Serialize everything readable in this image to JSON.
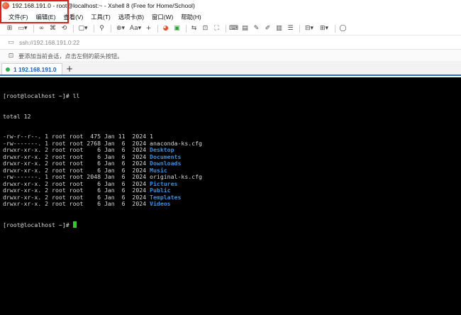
{
  "window": {
    "title": "192.168.191.0 - root@localhost:~ - Xshell 8 (Free for Home/School)"
  },
  "menu": [
    "文件(F)",
    "编辑(E)",
    "查看(V)",
    "工具(T)",
    "选项卡(B)",
    "窗口(W)",
    "帮助(H)"
  ],
  "address": {
    "value": "ssh://192.168.191.0:22"
  },
  "info": {
    "text": "要添加当前会话，点击左侧的箭头按钮。"
  },
  "tab": {
    "label": "1 192.168.191.0",
    "add_label": "+"
  },
  "terminal": {
    "prompt": "[root@localhost ~]# ",
    "command": "ll",
    "total": "total 12",
    "files": [
      {
        "meta": "-rw-r--r--. 1 root root  475 Jan 11  2024 ",
        "name": "1",
        "dir": false
      },
      {
        "meta": "-rw-------. 1 root root 2768 Jan  6  2024 ",
        "name": "anaconda-ks.cfg",
        "dir": false
      },
      {
        "meta": "drwxr-xr-x. 2 root root    6 Jan  6  2024 ",
        "name": "Desktop",
        "dir": true
      },
      {
        "meta": "drwxr-xr-x. 2 root root    6 Jan  6  2024 ",
        "name": "Documents",
        "dir": true
      },
      {
        "meta": "drwxr-xr-x. 2 root root    6 Jan  6  2024 ",
        "name": "Downloads",
        "dir": true
      },
      {
        "meta": "drwxr-xr-x. 2 root root    6 Jan  6  2024 ",
        "name": "Music",
        "dir": true
      },
      {
        "meta": "-rw-------. 1 root root 2048 Jan  6  2024 ",
        "name": "original-ks.cfg",
        "dir": false
      },
      {
        "meta": "drwxr-xr-x. 2 root root    6 Jan  6  2024 ",
        "name": "Pictures",
        "dir": true
      },
      {
        "meta": "drwxr-xr-x. 2 root root    6 Jan  6  2024 ",
        "name": "Public",
        "dir": true
      },
      {
        "meta": "drwxr-xr-x. 2 root root    6 Jan  6  2024 ",
        "name": "Templates",
        "dir": true
      },
      {
        "meta": "drwxr-xr-x. 2 root root    6 Jan  6  2024 ",
        "name": "Videos",
        "dir": true
      }
    ],
    "final_prompt": "[root@localhost ~]# "
  },
  "colors": {
    "accent": "#1f74c9",
    "highlight": "#d7221c",
    "dir": "#3a8fe0",
    "cursor": "#22d61e"
  }
}
